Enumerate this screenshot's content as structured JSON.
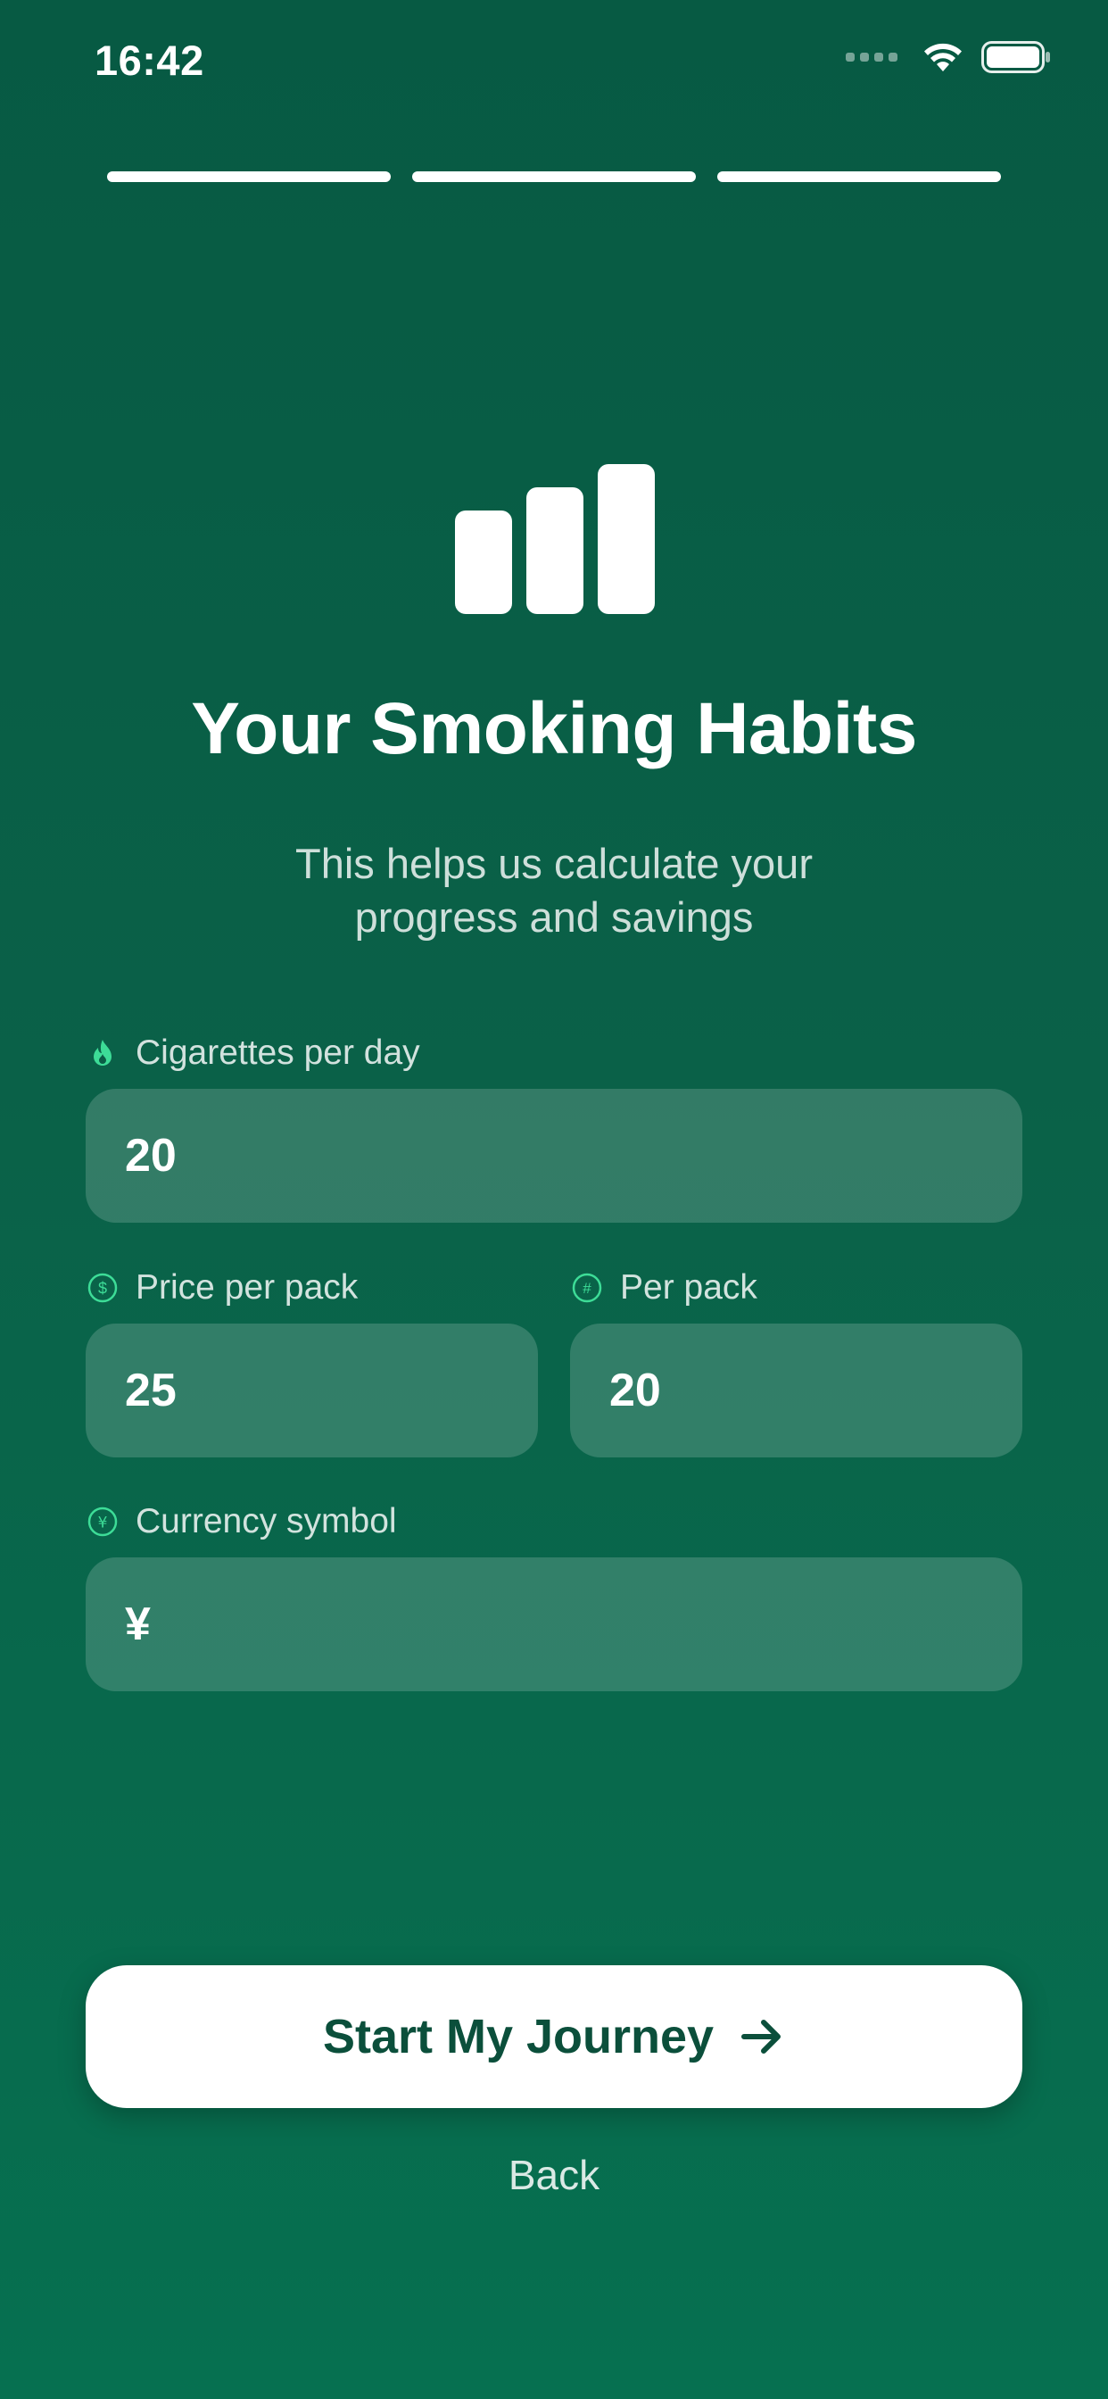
{
  "status_bar": {
    "time": "16:42",
    "icons": [
      "cellular-signal-icon",
      "wifi-icon",
      "battery-icon"
    ]
  },
  "progress": {
    "steps_total": 3,
    "steps_completed": 3
  },
  "header": {
    "icon": "bar-chart-icon",
    "title": "Your Smoking Habits",
    "subtitle_line1": "This helps us calculate your",
    "subtitle_line2": "progress and savings"
  },
  "form": {
    "cigarettes_per_day": {
      "label": "Cigarettes per day",
      "icon": "flame-icon",
      "value": "20"
    },
    "price_per_pack": {
      "label": "Price per pack",
      "icon": "dollar-circle-icon",
      "value": "25"
    },
    "per_pack": {
      "label": "Per pack",
      "icon": "number-circle-icon",
      "value": "20"
    },
    "currency_symbol": {
      "label": "Currency symbol",
      "icon": "yen-circle-icon",
      "value": "¥"
    }
  },
  "actions": {
    "primary_label": "Start My Journey",
    "primary_icon": "arrow-right-icon",
    "secondary_label": "Back"
  },
  "colors": {
    "background_top": "#075a43",
    "background_bottom": "#067050",
    "accent_icon": "#3ddc97",
    "button_text": "#0b4f3b",
    "input_fill": "rgba(255,255,255,0.17)"
  }
}
